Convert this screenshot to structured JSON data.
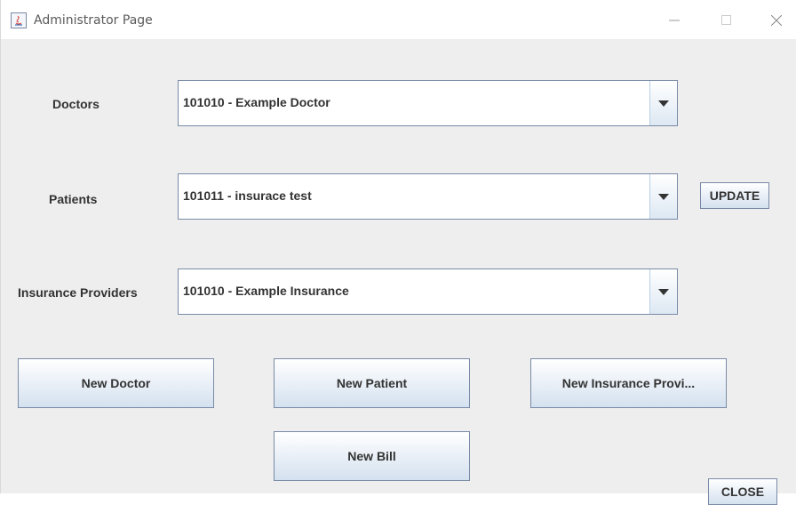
{
  "window": {
    "title": "Administrator Page",
    "controls": {
      "minimize_icon": "minimize-icon",
      "maximize_icon": "maximize-icon",
      "close_icon": "close-icon"
    }
  },
  "form": {
    "doctors": {
      "label": "Doctors",
      "selected": "101010 - Example Doctor"
    },
    "patients": {
      "label": "Patients",
      "selected": "101011 - insurace test"
    },
    "insurance": {
      "label": "Insurance Providers",
      "selected": "101010 - Example Insurance"
    }
  },
  "buttons": {
    "update": "UPDATE",
    "new_doctor": "New Doctor",
    "new_patient": "New Patient",
    "new_insurance": "New Insurance Provi...",
    "new_bill": "New Bill",
    "close": "CLOSE"
  },
  "colors": {
    "accent_border": "#7a8aa6",
    "button_gradient_bottom": "#d4e1ef",
    "background": "#eeeeee"
  }
}
